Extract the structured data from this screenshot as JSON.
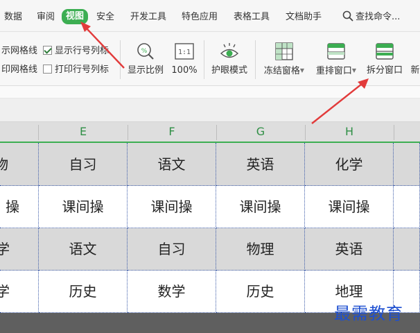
{
  "menu": {
    "items": [
      "数据",
      "审阅",
      "视图",
      "安全",
      "开发工具",
      "特色应用",
      "表格工具",
      "文档助手"
    ],
    "active_index": 2,
    "search_label": "查找命令..."
  },
  "ribbon": {
    "checkboxes": [
      {
        "label": "示网格线",
        "checked": false
      },
      {
        "label": "显示行号列标",
        "checked": true
      },
      {
        "label": "印网格线",
        "checked": false
      },
      {
        "label": "打印行号列标",
        "checked": false
      }
    ],
    "buttons": {
      "zoom_ratio": "显示比例",
      "zoom_100": "100%",
      "zoom_100_icon_text": "1:1",
      "eye_mode": "护眼模式",
      "freeze_panes": "冻结窗格",
      "rearrange_window": "重排窗口",
      "split_window": "拆分窗口",
      "new_window_partial": "新"
    }
  },
  "sheet": {
    "columns": [
      "E",
      "F",
      "G",
      "H"
    ],
    "rows": [
      {
        "partial": "物",
        "cells": [
          "自习",
          "语文",
          "英语",
          "化学"
        ]
      },
      {
        "partial": "操",
        "cells": [
          "课间操",
          "课间操",
          "课间操",
          "课间操"
        ]
      },
      {
        "partial": "学",
        "cells": [
          "语文",
          "自习",
          "物理",
          "英语"
        ]
      },
      {
        "partial": "学",
        "cells": [
          "历史",
          "数学",
          "历史",
          "地理"
        ]
      }
    ]
  },
  "watermark": "最需教育",
  "colors": {
    "accent_green": "#3cae52",
    "arrow_red": "#e23b3b",
    "watermark_blue": "#1d4fd1"
  }
}
